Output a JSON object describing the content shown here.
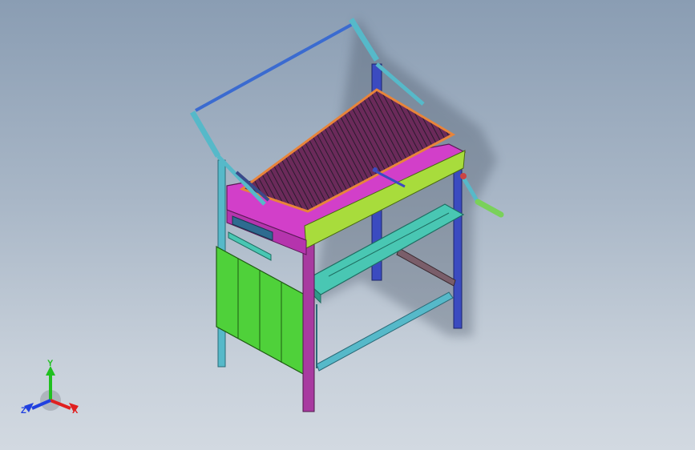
{
  "viewport": {
    "background_top": "#8a9db3",
    "background_bottom": "#d2d9e1"
  },
  "model": {
    "frame_color": "#2e3f9e",
    "leg_color": "#a83aa0",
    "panel_color": "#4fd13a",
    "tray_color": "#d23fc9",
    "shelf_color": "#49c7b3",
    "cyan_frame_color": "#56b9c9",
    "yellow_green_color": "#a8dc3c",
    "grid_edge_color": "#e8843a",
    "handle_color": "#7ad15a"
  },
  "triad": {
    "x_label": "X",
    "y_label": "Y",
    "z_label": "Z",
    "x_color": "#e02020",
    "y_color": "#20c020",
    "z_color": "#2040e0"
  }
}
